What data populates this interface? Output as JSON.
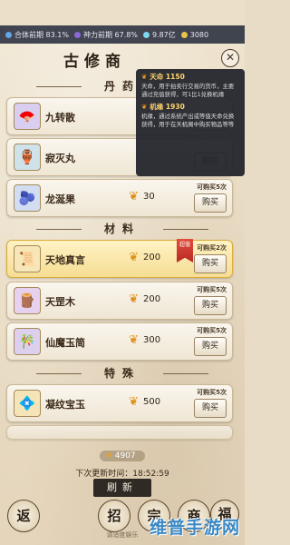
{
  "status": {
    "realm": "合体前期 83.1%",
    "power": "神力前期 67.8%",
    "stones": "9.87亿",
    "jade": "3080"
  },
  "title": "古修商",
  "sections": {
    "pills": "丹药",
    "materials": "材料",
    "special": "特殊"
  },
  "items": [
    {
      "name": "九转散",
      "price": "",
      "limit": "",
      "buy": "购买",
      "icon": "fan-icon"
    },
    {
      "name": "寂灭丸",
      "price": "",
      "limit": "",
      "buy": "购买",
      "icon": "vase-icon"
    },
    {
      "name": "龙涎果",
      "price": "30",
      "limit": "可购买5次",
      "buy": "购买",
      "icon": "fruit-icon"
    },
    {
      "name": "天地真言",
      "price": "200",
      "limit": "可购买2次",
      "buy": "购买",
      "icon": "scroll-icon",
      "badge": "超值"
    },
    {
      "name": "天罡木",
      "price": "200",
      "limit": "可购买5次",
      "buy": "购买",
      "icon": "wood-icon"
    },
    {
      "name": "仙魔玉简",
      "price": "300",
      "limit": "可购买5次",
      "buy": "购买",
      "icon": "slip-icon"
    },
    {
      "name": "凝纹宝玉",
      "price": "500",
      "limit": "可购买5次",
      "buy": "购买",
      "icon": "jade-icon"
    }
  ],
  "popup": {
    "line1_title": "天命 1150",
    "line1_desc": "天命，用于拍卖行交易的货币，主要通过充值获得，可1比1兑换机缘",
    "line2_title": "机缘 1930",
    "line2_desc": "机缘，通过系统产出或等值天命兑换获得，用于在天机阁中购买物品等等"
  },
  "footer": {
    "money": "4907",
    "refresh_label": "下次更新时间：18:52:59",
    "refresh_button": "刷新",
    "tip": "请适度娱乐"
  },
  "nav": [
    "返",
    "招",
    "宗",
    "商",
    "福"
  ],
  "watermark": "维普手游网",
  "colors": {
    "accent": "#e0901c",
    "highlight": "#f5dd93",
    "popup_bg": "#22242c",
    "watermark": "#3b88c4"
  }
}
